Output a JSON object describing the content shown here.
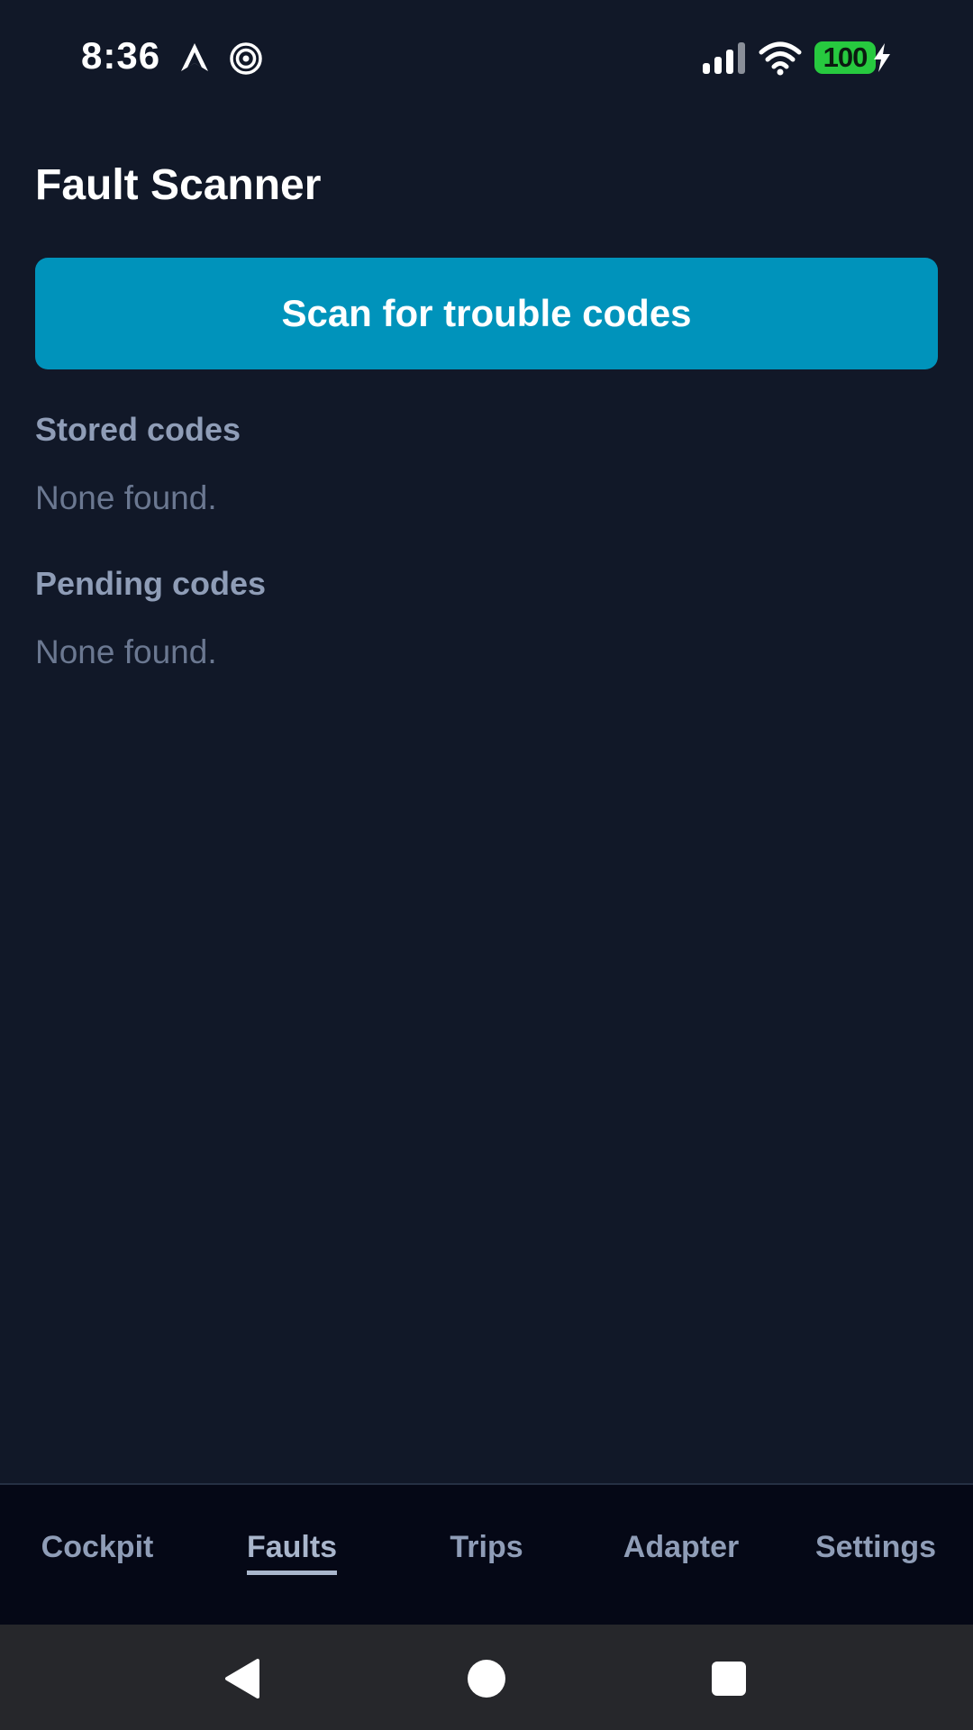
{
  "status_bar": {
    "time": "8:36",
    "battery_level": "100",
    "icons": [
      "navigation-arrow-icon",
      "spiral-icon",
      "cellular-signal-icon",
      "wifi-icon",
      "battery-icon",
      "charging-bolt-icon"
    ]
  },
  "page": {
    "title": "Fault Scanner"
  },
  "scan_button": {
    "label": "Scan for trouble codes"
  },
  "sections": [
    {
      "heading": "Stored codes",
      "empty_text": "None found."
    },
    {
      "heading": "Pending codes",
      "empty_text": "None found."
    }
  ],
  "tabs": [
    {
      "label": "Cockpit",
      "active": false
    },
    {
      "label": "Faults",
      "active": true
    },
    {
      "label": "Trips",
      "active": false
    },
    {
      "label": "Adapter",
      "active": false
    },
    {
      "label": "Settings",
      "active": false
    }
  ],
  "colors": {
    "background": "#111828",
    "accent": "#0093bb",
    "battery": "#27c93f",
    "tab_bar": "#050816",
    "nav_bar": "#26272b"
  }
}
